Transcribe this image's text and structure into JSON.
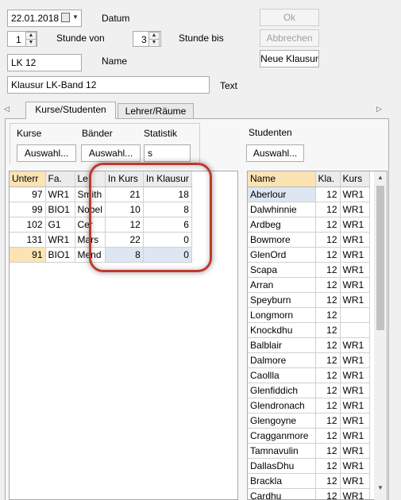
{
  "header": {
    "date_value": "22.01.2018",
    "date_label": "Datum",
    "stunde_von_value": "1",
    "stunde_von_label": "Stunde von",
    "stunde_bis_value": "3",
    "stunde_bis_label": "Stunde bis",
    "name_value": "LK 12",
    "name_label": "Name",
    "text_value": "Klausur LK-Band 12",
    "text_label": "Text"
  },
  "buttons": {
    "ok": "Ok",
    "cancel": "Abbrechen",
    "new_exam": "Neue Klausur"
  },
  "tabs": [
    {
      "label": "Kurse/Studenten",
      "active": true
    },
    {
      "label": "Lehrer/Räume",
      "active": false
    }
  ],
  "kurse_panel": {
    "tab_kurse": "Kurse",
    "tab_baender": "Bänder",
    "tab_statistik": "Statistik",
    "kurse_button": "Auswahl...",
    "baender_button": "Auswahl...",
    "statistik_value": "s"
  },
  "courses_table": {
    "headers": [
      "Unterr",
      "Fa.",
      "Le.",
      "In Kurs",
      "In Klausur"
    ],
    "rows": [
      {
        "unterr": "97",
        "fach": "WR1",
        "lehrer": "Smith",
        "in_kurs": "21",
        "in_klausur": "18"
      },
      {
        "unterr": "99",
        "fach": "BIO1",
        "lehrer": "Nobel",
        "in_kurs": "10",
        "in_klausur": "8"
      },
      {
        "unterr": "102",
        "fach": "G1",
        "lehrer": "Cer",
        "in_kurs": "12",
        "in_klausur": "6"
      },
      {
        "unterr": "131",
        "fach": "WR1",
        "lehrer": "Mars",
        "in_kurs": "22",
        "in_klausur": "0"
      },
      {
        "unterr": "91",
        "fach": "BIO1",
        "lehrer": "Mend",
        "in_kurs": "8",
        "in_klausur": "0"
      }
    ]
  },
  "students_panel": {
    "title": "Studenten",
    "button": "Auswahl...",
    "headers": [
      "Name",
      "Kla.",
      "Kurs"
    ],
    "rows": [
      {
        "name": "Aberlour",
        "kla": "12",
        "kurs": "WR1"
      },
      {
        "name": "Dalwhinnie",
        "kla": "12",
        "kurs": "WR1"
      },
      {
        "name": "Ardbeg",
        "kla": "12",
        "kurs": "WR1"
      },
      {
        "name": "Bowmore",
        "kla": "12",
        "kurs": "WR1"
      },
      {
        "name": "GlenOrd",
        "kla": "12",
        "kurs": "WR1"
      },
      {
        "name": "Scapa",
        "kla": "12",
        "kurs": "WR1"
      },
      {
        "name": "Arran",
        "kla": "12",
        "kurs": "WR1"
      },
      {
        "name": "Speyburn",
        "kla": "12",
        "kurs": "WR1"
      },
      {
        "name": "Longmorn",
        "kla": "12",
        "kurs": ""
      },
      {
        "name": "Knockdhu",
        "kla": "12",
        "kurs": ""
      },
      {
        "name": "Balblair",
        "kla": "12",
        "kurs": "WR1"
      },
      {
        "name": "Dalmore",
        "kla": "12",
        "kurs": "WR1"
      },
      {
        "name": "Caollla",
        "kla": "12",
        "kurs": "WR1"
      },
      {
        "name": "Glenfiddich",
        "kla": "12",
        "kurs": "WR1"
      },
      {
        "name": "Glendronach",
        "kla": "12",
        "kurs": "WR1"
      },
      {
        "name": "Glengoyne",
        "kla": "12",
        "kurs": "WR1"
      },
      {
        "name": "Cragganmore",
        "kla": "12",
        "kurs": "WR1"
      },
      {
        "name": "Tamnavulin",
        "kla": "12",
        "kurs": "WR1"
      },
      {
        "name": "DallasDhu",
        "kla": "12",
        "kurs": "WR1"
      },
      {
        "name": "Brackla",
        "kla": "12",
        "kurs": "WR1"
      },
      {
        "name": "Cardhu",
        "kla": "12",
        "kurs": "WR1"
      }
    ]
  },
  "colors": {
    "highlight_ring": "#c0392b",
    "selected_header": "#fbe3b3"
  }
}
